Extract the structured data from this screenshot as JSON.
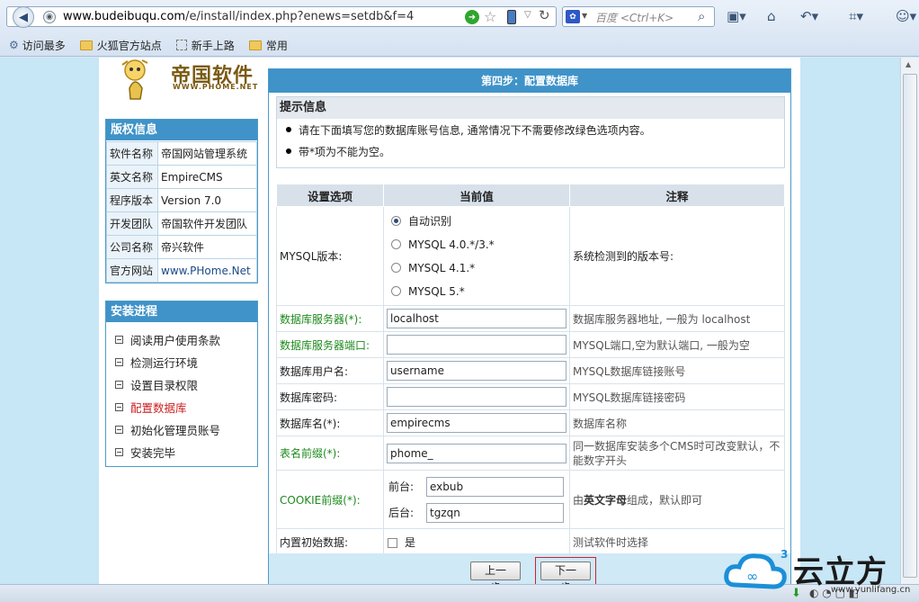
{
  "browser": {
    "url_host": "www.budeibuqu.com",
    "url_path": "/e/install/index.php?enews=setdb&f=4",
    "search_placeholder": "百度 <Ctrl+K>",
    "bookmarks": [
      "访问最多",
      "火狐官方站点",
      "新手上路",
      "常用"
    ]
  },
  "logo": {
    "text": "帝国软件",
    "sub": "WWW.PHOME.NET"
  },
  "copyright": {
    "title": "版权信息",
    "rows": [
      {
        "k": "软件名称",
        "v": "帝国网站管理系统"
      },
      {
        "k": "英文名称",
        "v": "EmpireCMS"
      },
      {
        "k": "程序版本",
        "v": "Version 7.0"
      },
      {
        "k": "开发团队",
        "v": "帝国软件开发团队"
      },
      {
        "k": "公司名称",
        "v": "帝兴软件"
      },
      {
        "k": "官方网站",
        "v": "www.PHome.Net"
      }
    ]
  },
  "progress": {
    "title": "安装进程",
    "steps": [
      "阅读用户使用条款",
      "检测运行环境",
      "设置目录权限",
      "配置数据库",
      "初始化管理员账号",
      "安装完毕"
    ]
  },
  "main": {
    "title": "第四步：配置数据库",
    "info_title": "提示信息",
    "info_lines": [
      "请在下面填写您的数据库账号信息, 通常情况下不需要修改绿色选项内容。",
      "带*项为不能为空。"
    ],
    "headers": [
      "设置选项",
      "当前值",
      "注释"
    ],
    "mysql": {
      "label": "MYSQL版本:",
      "options": [
        "自动识别",
        "MYSQL 4.0.*/3.*",
        "MYSQL 4.1.*",
        "MYSQL 5.*"
      ],
      "note": "系统检测到的版本号:"
    },
    "rows": [
      {
        "label": "数据库服务器(*):",
        "value": "localhost",
        "note": "数据库服务器地址, 一般为 localhost"
      },
      {
        "label": "数据库服务器端口:",
        "value": "",
        "note": "MYSQL端口,空为默认端口, 一般为空"
      },
      {
        "label": "数据库用户名:",
        "value": "username",
        "note": "MYSQL数据库链接账号"
      },
      {
        "label": "数据库密码:",
        "value": "",
        "note": "MYSQL数据库链接密码"
      },
      {
        "label": "数据库名(*):",
        "value": "empirecms",
        "note": "数据库名称"
      },
      {
        "label": "表名前缀(*):",
        "value": "phome_",
        "note": "同一数据库安装多个CMS时可改变默认，不能数字开头"
      }
    ],
    "cookie": {
      "label": "COOKIE前缀(*):",
      "front_label": "前台:",
      "front_value": "exbub",
      "back_label": "后台:",
      "back_value": "tgzqn",
      "note_pre": "由",
      "note_bold": "英文字母",
      "note_post": "组成，默认即可"
    },
    "builtin": {
      "label": "内置初始数据:",
      "check_label": "是",
      "note": "测试软件时选择"
    },
    "prev_button": "上一步",
    "next_button": "下一步"
  },
  "watermark": {
    "text": "云立方",
    "url": "www.yunlifang.cn"
  }
}
